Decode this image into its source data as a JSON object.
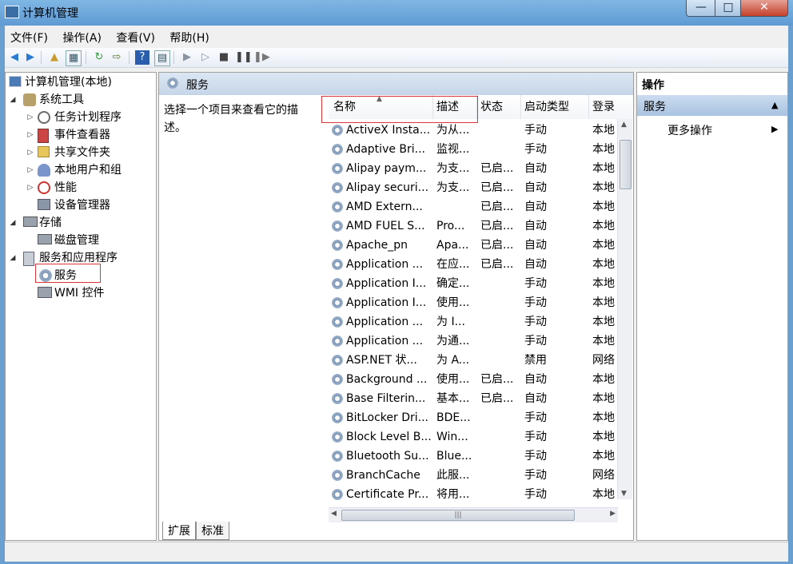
{
  "window": {
    "title": "计算机管理",
    "controls": {
      "minimize": "—",
      "maximize": "□",
      "close": "✕"
    }
  },
  "menu": [
    "文件(F)",
    "操作(A)",
    "查看(V)",
    "帮助(H)"
  ],
  "tree": {
    "root": "计算机管理(本地)",
    "system_tools": "系统工具",
    "task_scheduler": "任务计划程序",
    "event_viewer": "事件查看器",
    "shared_folders": "共享文件夹",
    "local_users": "本地用户和组",
    "performance": "性能",
    "device_manager": "设备管理器",
    "storage": "存储",
    "disk_management": "磁盘管理",
    "services_apps": "服务和应用程序",
    "services": "服务",
    "wmi": "WMI 控件"
  },
  "center": {
    "title": "服务",
    "description": "选择一个项目来查看它的描述。",
    "columns": {
      "name": "名称",
      "desc": "描述",
      "status": "状态",
      "startup": "启动类型",
      "logon": "登录"
    },
    "rows": [
      {
        "name": "ActiveX Insta...",
        "desc": "为从...",
        "status": "",
        "startup": "手动",
        "logon": "本地"
      },
      {
        "name": "Adaptive Bri...",
        "desc": "监视...",
        "status": "",
        "startup": "手动",
        "logon": "本地"
      },
      {
        "name": "Alipay paym...",
        "desc": "为支...",
        "status": "已启...",
        "startup": "自动",
        "logon": "本地"
      },
      {
        "name": "Alipay securi...",
        "desc": "为支...",
        "status": "已启...",
        "startup": "自动",
        "logon": "本地"
      },
      {
        "name": "AMD Extern...",
        "desc": "",
        "status": "已启...",
        "startup": "自动",
        "logon": "本地"
      },
      {
        "name": "AMD FUEL S...",
        "desc": "Pro...",
        "status": "已启...",
        "startup": "自动",
        "logon": "本地"
      },
      {
        "name": "Apache_pn",
        "desc": "Apa...",
        "status": "已启...",
        "startup": "自动",
        "logon": "本地"
      },
      {
        "name": "Application ...",
        "desc": "在应...",
        "status": "已启...",
        "startup": "自动",
        "logon": "本地"
      },
      {
        "name": "Application I...",
        "desc": "确定...",
        "status": "",
        "startup": "手动",
        "logon": "本地"
      },
      {
        "name": "Application I...",
        "desc": "使用...",
        "status": "",
        "startup": "手动",
        "logon": "本地"
      },
      {
        "name": "Application ...",
        "desc": "为 I...",
        "status": "",
        "startup": "手动",
        "logon": "本地"
      },
      {
        "name": "Application ...",
        "desc": "为通...",
        "status": "",
        "startup": "手动",
        "logon": "本地"
      },
      {
        "name": "ASP.NET 状...",
        "desc": "为 A...",
        "status": "",
        "startup": "禁用",
        "logon": "网络"
      },
      {
        "name": "Background ...",
        "desc": "使用...",
        "status": "已启...",
        "startup": "自动",
        "logon": "本地"
      },
      {
        "name": "Base Filterin...",
        "desc": "基本...",
        "status": "已启...",
        "startup": "自动",
        "logon": "本地"
      },
      {
        "name": "BitLocker Dri...",
        "desc": "BDE...",
        "status": "",
        "startup": "手动",
        "logon": "本地"
      },
      {
        "name": "Block Level B...",
        "desc": "Win...",
        "status": "",
        "startup": "手动",
        "logon": "本地"
      },
      {
        "name": "Bluetooth Su...",
        "desc": "Blue...",
        "status": "",
        "startup": "手动",
        "logon": "本地"
      },
      {
        "name": "BranchCache",
        "desc": "此服...",
        "status": "",
        "startup": "手动",
        "logon": "网络"
      },
      {
        "name": "Certificate Pr...",
        "desc": "将用...",
        "status": "",
        "startup": "手动",
        "logon": "本地"
      }
    ],
    "tabs": [
      "扩展",
      "标准"
    ]
  },
  "actions": {
    "title": "操作",
    "section": "服务",
    "more": "更多操作"
  }
}
